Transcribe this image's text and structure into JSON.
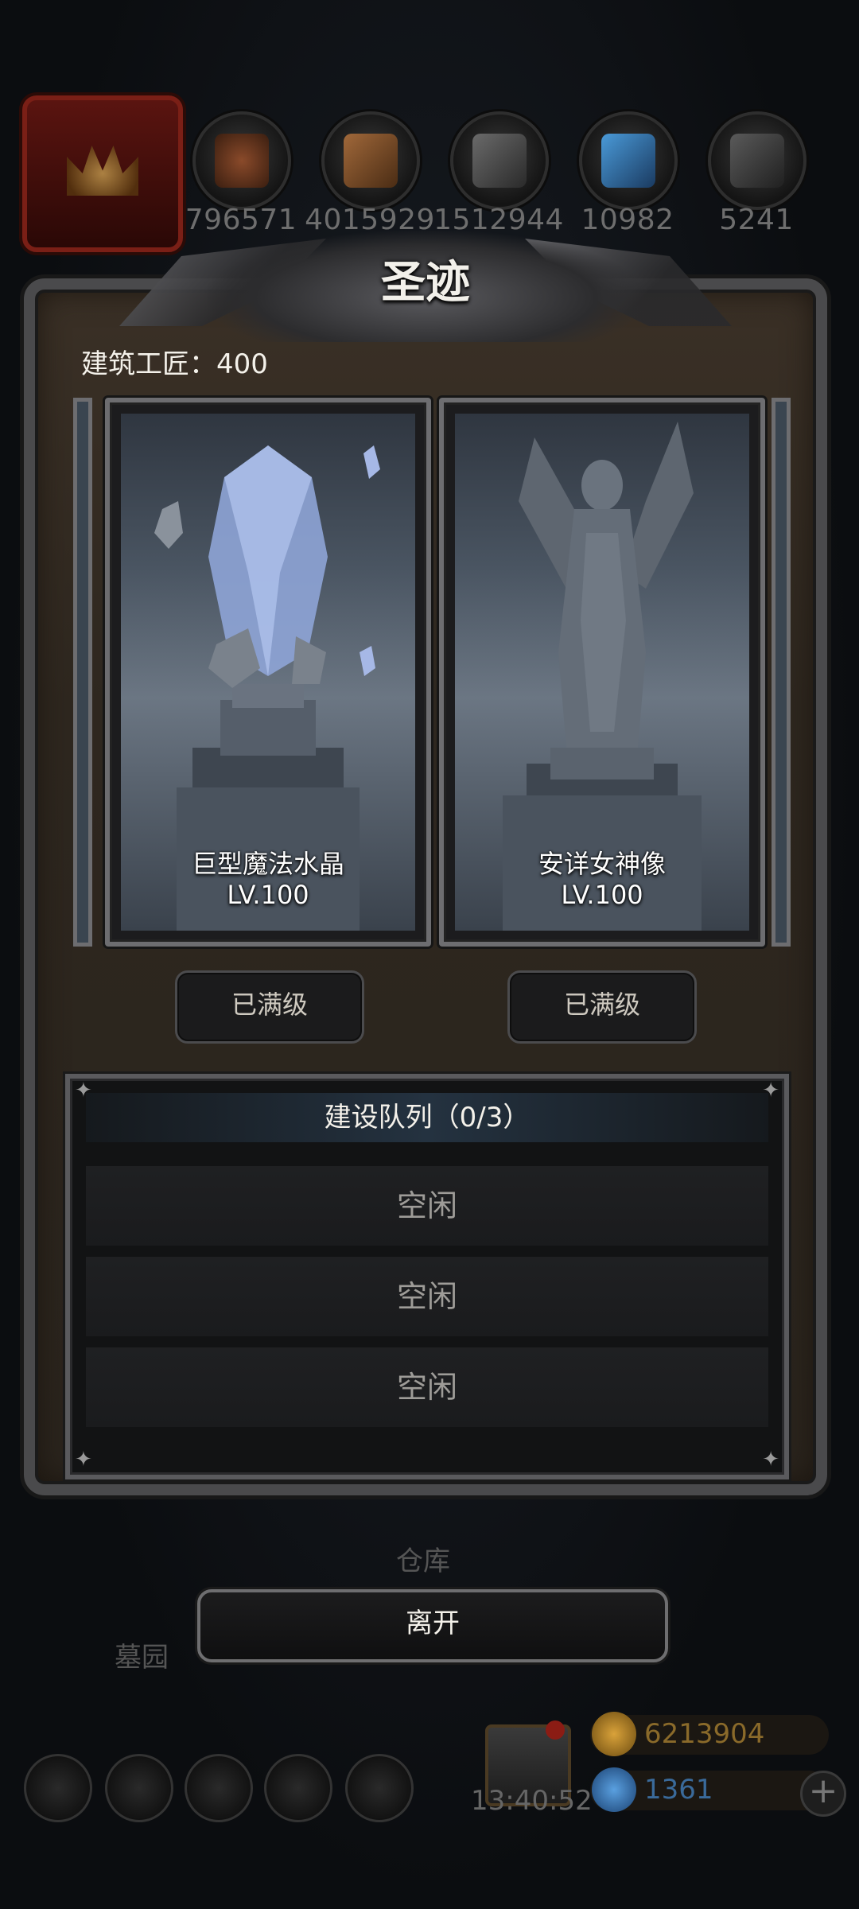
{
  "top_bar": {
    "resources": [
      {
        "icon": "meat-icon",
        "value": "796571",
        "color": "#8a4a2a"
      },
      {
        "icon": "wood-icon",
        "value": "4015929",
        "color": "#8a5a30"
      },
      {
        "icon": "iron-icon",
        "value": "1512944",
        "color": "#555555"
      },
      {
        "icon": "crystal-icon",
        "value": "10982",
        "color": "#2a6fa8"
      },
      {
        "icon": "stone-icon",
        "value": "5241",
        "color": "#4a4a4a"
      }
    ]
  },
  "modal": {
    "title": "圣迹",
    "builders_label": "建筑工匠：400",
    "cards": [
      {
        "name": "巨型魔法水晶",
        "level": "LV.100",
        "button": "已满级"
      },
      {
        "name": "安详女神像",
        "level": "LV.100",
        "button": "已满级"
      }
    ],
    "queue": {
      "title": "建设队列（0/3）",
      "slots": [
        "空闲",
        "空闲",
        "空闲"
      ]
    },
    "leave_label": "离开"
  },
  "background": {
    "warehouse_label": "仓库",
    "cemetery_label": "墓园",
    "timer": "13:40:52",
    "gold": "6213904",
    "gems": "1361",
    "gold_color": "#b8862a",
    "gem_color": "#3a7ab8"
  }
}
